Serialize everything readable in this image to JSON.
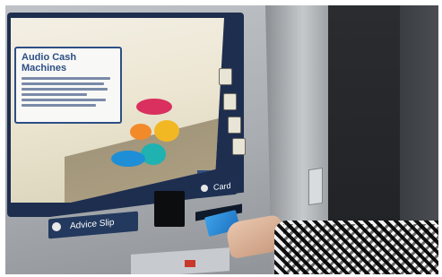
{
  "screen": {
    "callout_title": "Audio Cash Machines"
  },
  "panel": {
    "advice_slip_label": "Advice Slip",
    "card_label": "Card"
  },
  "colors": {
    "bubble_red": "#d9305f",
    "bubble_orange": "#f28a2a",
    "bubble_yellow": "#f2b824",
    "bubble_teal": "#1fb2b0",
    "bubble_blue": "#1e8ed6",
    "atm_navy": "#23395e"
  }
}
